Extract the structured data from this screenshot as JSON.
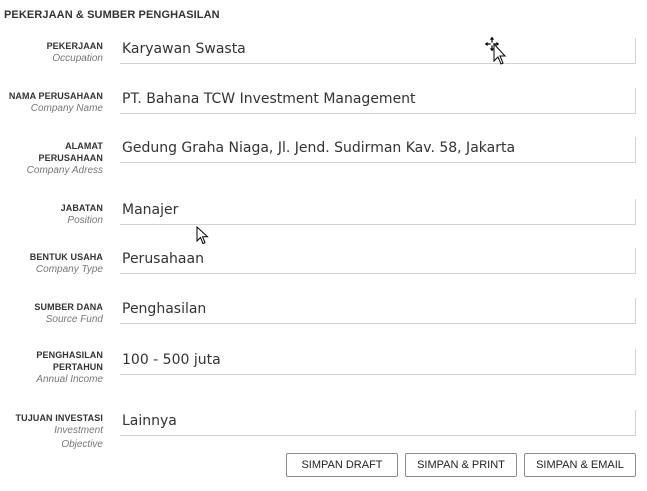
{
  "section": {
    "title": "PEKERJAAN & SUMBER PENGHASILAN"
  },
  "fields": {
    "occupation": {
      "label": "PEKERJAAN",
      "sublabel": "Occupation",
      "value": "Karyawan Swasta"
    },
    "company_name": {
      "label": "NAMA PERUSAHAAN",
      "sublabel": "Company Name",
      "value": "PT. Bahana TCW Investment Management"
    },
    "company_address": {
      "label_line1": "ALAMAT",
      "label_line2": "PERUSAHAAN",
      "sublabel": "Company Adress",
      "value": "Gedung Graha Niaga, Jl. Jend. Sudirman Kav. 58, Jakarta"
    },
    "position": {
      "label": "JABATAN",
      "sublabel": "Position",
      "value": "Manajer"
    },
    "company_type": {
      "label": "BENTUK USAHA",
      "sublabel": "Company Type",
      "value": "Perusahaan"
    },
    "source_fund": {
      "label": "SUMBER DANA",
      "sublabel": "Source Fund",
      "value": "Penghasilan"
    },
    "annual_income": {
      "label_line1": "PENGHASILAN",
      "label_line2": "PERTAHUN",
      "sublabel": "Annual Income",
      "value": "100 - 500 juta"
    },
    "investment_objective": {
      "label": "TUJUAN INVESTASI",
      "sublabel_line1": "Investment",
      "sublabel_line2": "Objective",
      "value": "Lainnya"
    }
  },
  "buttons": {
    "save_draft": "SIMPAN DRAFT",
    "save_print": "SIMPAN & PRINT",
    "save_email": "SIMPAN & EMAIL"
  },
  "icons": {
    "move_cursor": "move-cursor-icon",
    "arrow_cursor": "arrow-cursor-icon"
  }
}
